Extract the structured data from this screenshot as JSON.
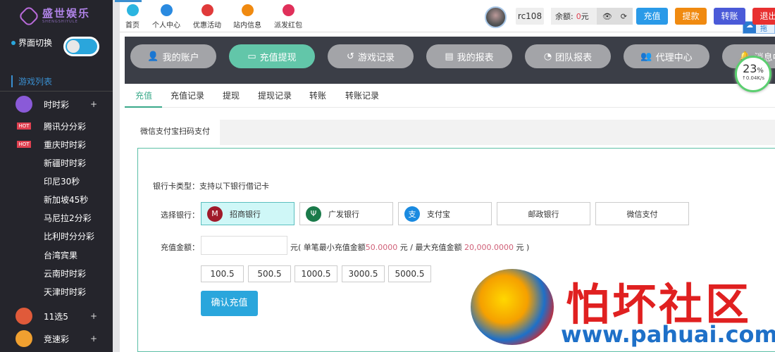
{
  "brand": {
    "name": "盛世娱乐",
    "sub": "SHENGSHIYULE"
  },
  "sidebar": {
    "switch_label": "界面切换",
    "list_title": "游戏列表",
    "games": [
      {
        "label": "时时彩",
        "type": "group",
        "color": "#8a5ad8"
      },
      {
        "label": "腾讯分分彩",
        "type": "hot"
      },
      {
        "label": "重庆时时彩",
        "type": "hot"
      },
      {
        "label": "新疆时时彩",
        "type": "plain"
      },
      {
        "label": "印尼30秒",
        "type": "plain"
      },
      {
        "label": "新加坡45秒",
        "type": "plain"
      },
      {
        "label": "马尼拉2分彩",
        "type": "plain"
      },
      {
        "label": "比利时分分彩",
        "type": "plain"
      },
      {
        "label": "台湾宾果",
        "type": "plain"
      },
      {
        "label": "云南时时彩",
        "type": "plain"
      },
      {
        "label": "天津时时彩",
        "type": "plain"
      },
      {
        "label": "11选5",
        "type": "group",
        "color": "#e05a3a"
      },
      {
        "label": "竞速彩",
        "type": "group",
        "color": "#f0a030"
      }
    ],
    "hot_badge": "HOT",
    "plus": "+"
  },
  "topnav": [
    {
      "label": "首页",
      "color": "#2bb5e0"
    },
    {
      "label": "个人中心",
      "color": "#2a8ae0"
    },
    {
      "label": "优惠活动",
      "color": "#e03a3a"
    },
    {
      "label": "站内信息",
      "color": "#f08a10"
    },
    {
      "label": "派发红包",
      "color": "#e0305a"
    }
  ],
  "user": {
    "name": "rc108",
    "balance_label": "余额:",
    "balance": "0",
    "currency": "元"
  },
  "actions": [
    {
      "label": "充值",
      "color": "#2a9ae8"
    },
    {
      "label": "提款",
      "color": "#f08a10"
    },
    {
      "label": "转账",
      "color": "#4a5ad8"
    },
    {
      "label": "退出",
      "color": "#e83030"
    }
  ],
  "cloud_text": "拖",
  "main_nav": [
    {
      "label": "我的账户",
      "icon": "user-icon",
      "glyph": "👤"
    },
    {
      "label": "充值提现",
      "icon": "card-icon",
      "glyph": "▭"
    },
    {
      "label": "游戏记录",
      "icon": "history-icon",
      "glyph": "↺"
    },
    {
      "label": "我的报表",
      "icon": "document-icon",
      "glyph": "▤"
    },
    {
      "label": "团队报表",
      "icon": "pie-chart-icon",
      "glyph": "◔"
    },
    {
      "label": "代理中心",
      "icon": "users-icon",
      "glyph": "👥"
    },
    {
      "label": "消息中心",
      "icon": "bell-icon",
      "glyph": "🔔"
    }
  ],
  "tabs": [
    "充值",
    "充值记录",
    "提现",
    "提现记录",
    "转账",
    "转账记录"
  ],
  "subtab": "微信支付宝扫码支付",
  "form": {
    "card_type_label": "银行卡类型：",
    "card_type_value": "支持以下银行借记卡",
    "select_bank_label": "选择银行：",
    "banks": [
      {
        "label": "招商银行",
        "color": "#a01a2a",
        "glyph": "M"
      },
      {
        "label": "广发银行",
        "color": "#1a7a4a",
        "glyph": "Ψ"
      },
      {
        "label": "支付宝",
        "color": "#1a8ae0",
        "glyph": "支"
      },
      {
        "label": "邮政银行"
      },
      {
        "label": "微信支付"
      }
    ],
    "amount_label": "充值金额：",
    "amount_value": "",
    "unit": "元",
    "hint_a": "( 单笔最小充值金额",
    "min": "50.0000",
    "hint_b": " 元 / 最大充值金额 ",
    "max": "20,000.0000",
    "hint_c": " 元 )",
    "quick_amounts": [
      "100.5",
      "500.5",
      "1000.5",
      "3000.5",
      "5000.5"
    ],
    "confirm": "确认充值"
  },
  "speed": {
    "percent": "23",
    "unit": "%",
    "rate": "↑0.04K/s"
  },
  "watermark": {
    "title": "怕坏社区",
    "url": "www.pahuai.com"
  }
}
